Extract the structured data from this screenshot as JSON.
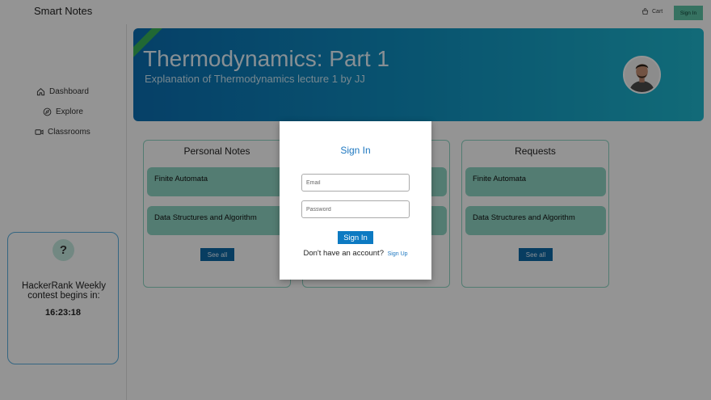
{
  "app": {
    "brand": "Smart Notes"
  },
  "topbar": {
    "cart_label": "Cart",
    "signin_label": "Sign In"
  },
  "sidebar": {
    "items": [
      {
        "label": "Dashboard",
        "icon": "home-icon"
      },
      {
        "label": "Explore",
        "icon": "compass-icon"
      },
      {
        "label": "Classrooms",
        "icon": "video-icon"
      }
    ],
    "contest": {
      "icon_text": "?",
      "text": "HackerRank Weekly contest begins in:",
      "countdown": "16:23:18"
    }
  },
  "banner": {
    "title": "Thermodynamics: Part 1",
    "subtitle": "Explanation of Thermodynamics lecture 1 by JJ",
    "colors": {
      "start": "#0b6fb3",
      "end": "#1fb8cf"
    }
  },
  "panels": [
    {
      "title": "Personal Notes",
      "cards": [
        "Finite Automata",
        "Data Structures and Algorithm"
      ],
      "see_all": "See all"
    },
    {
      "title": "",
      "cards": [
        "",
        ""
      ],
      "see_all": ""
    },
    {
      "title": "Requests",
      "cards": [
        "Finite Automata",
        "Data Structures and Algorithm"
      ],
      "see_all": "See all"
    }
  ],
  "modal": {
    "title": "Sign In",
    "email_placeholder": "Email",
    "password_placeholder": "Password",
    "signin_button": "Sign In",
    "no_account_text": "Don't have an account?",
    "signup_link": "Sign Up"
  },
  "colors": {
    "accent": "#1d77c0",
    "teal": "#8fd6c4",
    "button_dark": "#0d6aa8"
  }
}
